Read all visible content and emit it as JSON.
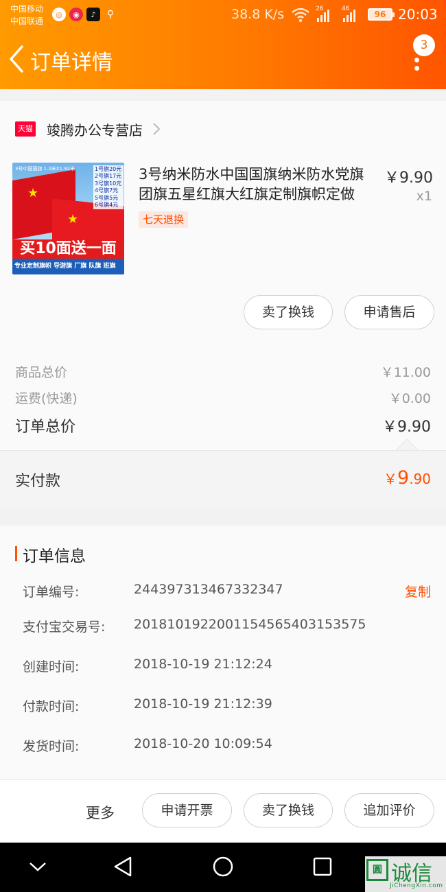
{
  "status_bar": {
    "carrier_1": "中国移动",
    "carrier_2": "中国联通",
    "net_speed": "38.8 K/s",
    "signal_1": "26",
    "signal_2": "46",
    "battery": "96",
    "time": "20:03"
  },
  "nav": {
    "title": "订单详情",
    "badge_count": "3"
  },
  "shop": {
    "badge": "天猫",
    "name": "竣腾办公专营店"
  },
  "product": {
    "title": "3号纳米防水中国国旗纳米防水党旗团旗五星红旗大红旗定制旗帜定做",
    "price": "￥9.90",
    "quantity": "x1",
    "tag": "七天退换",
    "thumb_header": "3号中国国旗 1.2米X1.92米",
    "thumb_list": [
      "1号旗20元",
      "2号旗17元",
      "3号旗10元",
      "4号旗7元",
      "5号旗5元",
      "6号旗4元"
    ],
    "thumb_promo": "买10面送一面",
    "thumb_tags": "专业定制旗帜 导游旗 厂旗 队旗 班旗"
  },
  "item_actions": {
    "sell": "卖了换钱",
    "after_sale": "申请售后"
  },
  "fees": {
    "goods_label": "商品总价",
    "goods_value": "￥11.00",
    "shipping_label": "运费(快递)",
    "shipping_value": "￥0.00",
    "total_label": "订单总价",
    "total_value": "￥9.90"
  },
  "paid": {
    "label": "实付款",
    "currency": "￥",
    "integer": "9",
    "decimal": ".90"
  },
  "order_info": {
    "heading": "订单信息",
    "copy_label": "复制",
    "rows": [
      {
        "key": "订单编号:",
        "value": "244397313467332347"
      },
      {
        "key": "支付宝交易号:",
        "value": "2018101922001154565403153575"
      },
      {
        "key": "创建时间:",
        "value": "2018-10-19 21:12:24"
      },
      {
        "key": "付款时间:",
        "value": "2018-10-19 21:12:39"
      },
      {
        "key": "发货时间:",
        "value": "2018-10-20 10:09:54"
      }
    ]
  },
  "bottom_actions": {
    "more": "更多",
    "invoice": "申请开票",
    "sell": "卖了换钱",
    "review": "追加评价"
  },
  "watermark": {
    "box": "圓",
    "text": "诚信",
    "sub": "JiChengXin.com"
  },
  "colors": {
    "header_start": "#ff9a00",
    "header_end": "#ff5500",
    "accent": "#ff5000",
    "tmall_red": "#ff0036"
  }
}
